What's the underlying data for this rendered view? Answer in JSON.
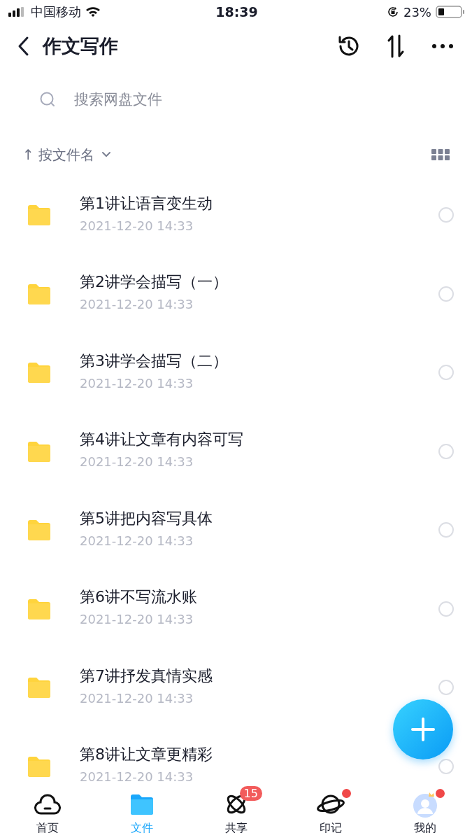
{
  "status_bar": {
    "carrier": "中国移动",
    "time": "18:39",
    "battery": "23%"
  },
  "header": {
    "title": "作文写作"
  },
  "search": {
    "placeholder": "搜索网盘文件"
  },
  "sort": {
    "arrow": "↑",
    "label": "按文件名"
  },
  "files": [
    {
      "name": "第1讲让语言变生动",
      "date": "2021-12-20 14:33",
      "selected": false
    },
    {
      "name": "第2讲学会描写（一）",
      "date": "2021-12-20 14:33",
      "selected": false
    },
    {
      "name": "第3讲学会描写（二）",
      "date": "2021-12-20 14:33",
      "selected": false
    },
    {
      "name": "第4讲让文章有内容可写",
      "date": "2021-12-20 14:33",
      "selected": false
    },
    {
      "name": "第5讲把内容写具体",
      "date": "2021-12-20 14:33",
      "selected": false
    },
    {
      "name": "第6讲不写流水账",
      "date": "2021-12-20 14:33",
      "selected": false
    },
    {
      "name": "第7讲抒发真情实感",
      "date": "2021-12-20 14:33",
      "selected": false
    },
    {
      "name": "第8讲让文章更精彩",
      "date": "2021-12-20 14:33",
      "selected": false
    }
  ],
  "tabs": [
    {
      "kind": "home",
      "label": "首页",
      "selected": false
    },
    {
      "kind": "files",
      "label": "文件",
      "selected": true
    },
    {
      "kind": "share",
      "label": "共享",
      "selected": false,
      "badge": "15"
    },
    {
      "kind": "planet",
      "label": "印记",
      "selected": false,
      "dot": true
    },
    {
      "kind": "me",
      "label": "我的",
      "selected": false,
      "dot": true
    }
  ]
}
